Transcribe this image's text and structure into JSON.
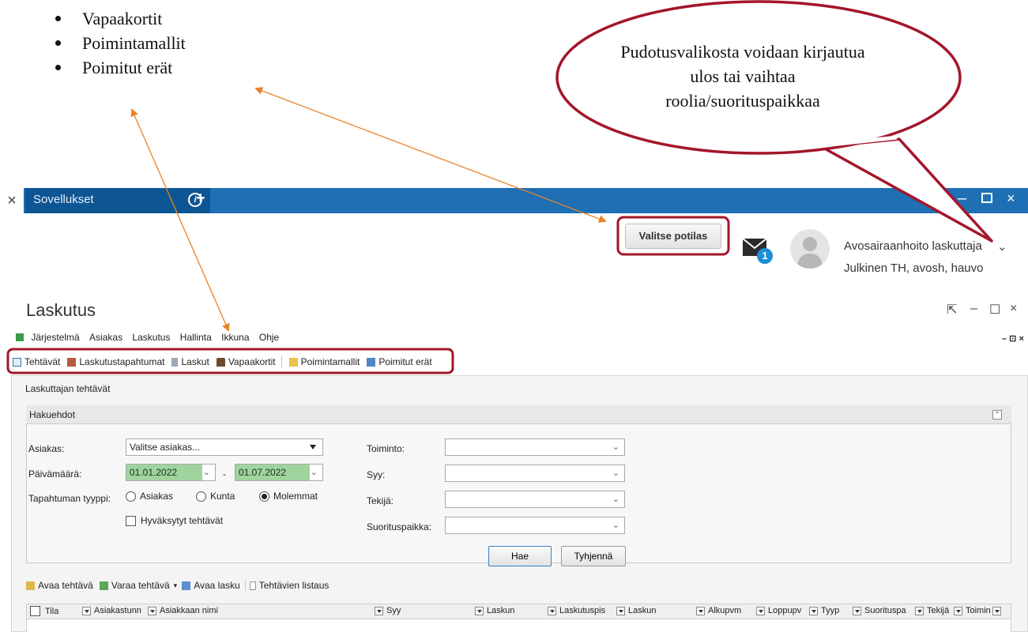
{
  "annotation": {
    "bullets": [
      "Vapaakortit",
      "Poimintamallit",
      "Poimitut erät"
    ],
    "callout": "Pudotusvalikosta voidaan kirjautua ulos tai vaihtaa roolia/suorituspaikkaa",
    "highlight_color": "#a3162b",
    "arrow_color": "#e8842a"
  },
  "titlebar": {
    "close_glyph": "×",
    "tab_label": "Sovellukset",
    "info_glyph": "i",
    "plus_glyph": "+",
    "min_glyph": "–",
    "close_btn_glyph": "×",
    "color": "#1f6fb5"
  },
  "header": {
    "select_patient": "Valitse potilas",
    "mail_badge": "1",
    "user_name": "Avosairaanhoito laskuttaja",
    "user_dept": "Julkinen TH, avosh, hauvo",
    "chevron": "⌄"
  },
  "window": {
    "title": "Laskutus",
    "pin_glyph": "⇱",
    "min_glyph": "–",
    "max_glyph": "☐",
    "close_glyph": "×"
  },
  "menu": {
    "items": [
      "Järjestelmä",
      "Asiakas",
      "Laskutus",
      "Hallinta",
      "Ikkuna",
      "Ohje"
    ],
    "mdi_controls": "– ⊡ ×"
  },
  "toolbar": {
    "items": [
      "Tehtävät",
      "Laskutustapahtumat",
      "Laskut",
      "Vapaakortit",
      "Poimintamallit",
      "Poimitut erät"
    ]
  },
  "panel": {
    "title": "Laskuttajan tehtävät",
    "search_title": "Hakuehdot",
    "collapse_glyph": "⌃"
  },
  "form": {
    "customer_label": "Asiakas:",
    "customer_value": "Valitse asiakas...",
    "date_label": "Päivämäärä:",
    "date_from": "01.01.2022",
    "date_sep": "-",
    "date_to": "01.07.2022",
    "type_label": "Tapahtuman tyyppi:",
    "type_options": [
      "Asiakas",
      "Kunta",
      "Molemmat"
    ],
    "type_selected": "Molemmat",
    "approved_label": "Hyväksytyt tehtävät",
    "action_label": "Toiminto:",
    "reason_label": "Syy:",
    "maker_label": "Tekijä:",
    "place_label": "Suorituspaikka:",
    "search_btn": "Hae",
    "clear_btn": "Tyhjennä"
  },
  "actions": {
    "items": [
      "Avaa tehtävä",
      "Varaa tehtävä",
      "Avaa lasku",
      "Tehtävien listaus"
    ]
  },
  "grid": {
    "columns": [
      "Tila",
      "Asiakastunn",
      "Asiakkaan nimi",
      "Syy",
      "Laskun",
      "Laskutuspis",
      "Laskun",
      "Alkupvm",
      "Loppupv",
      "Tyyp",
      "Suorituspa",
      "Tekijä",
      "Toimin"
    ]
  }
}
